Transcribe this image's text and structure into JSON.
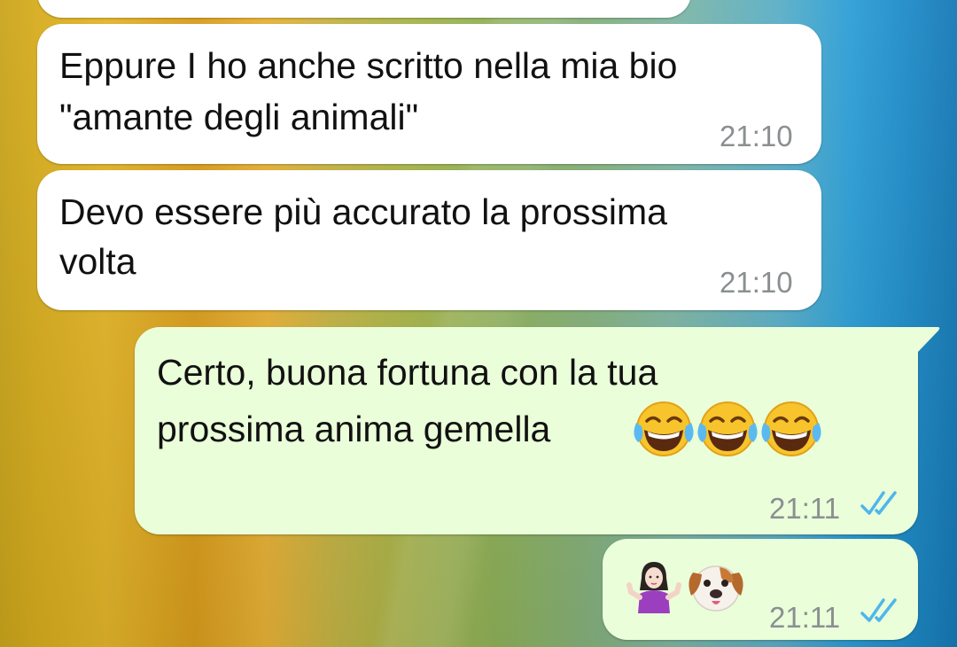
{
  "messages": [
    {
      "direction": "incoming",
      "text": ""
    },
    {
      "direction": "incoming",
      "line1": "Eppure I ho anche scritto nella mia bio",
      "line2": "\"amante degli animali\"",
      "time": "21:10"
    },
    {
      "direction": "incoming",
      "line1": "Devo essere più accurato la prossima",
      "line2": "volta",
      "time": "21:10"
    },
    {
      "direction": "outgoing",
      "line1": "Certo, buona fortuna con la tua",
      "line2": "prossima anima gemella",
      "emojis": [
        "face-with-tears-of-joy",
        "face-with-tears-of-joy",
        "face-with-tears-of-joy"
      ],
      "time": "21:11",
      "status": "read"
    },
    {
      "direction": "outgoing",
      "emojis": [
        "woman-shrugging",
        "dog-face"
      ],
      "time": "21:11",
      "status": "read"
    }
  ],
  "colors": {
    "incoming_bubble": "#ffffff",
    "outgoing_bubble": "#eafed9",
    "read_ticks": "#4fb6ec",
    "timestamp": "#8b8f91"
  }
}
